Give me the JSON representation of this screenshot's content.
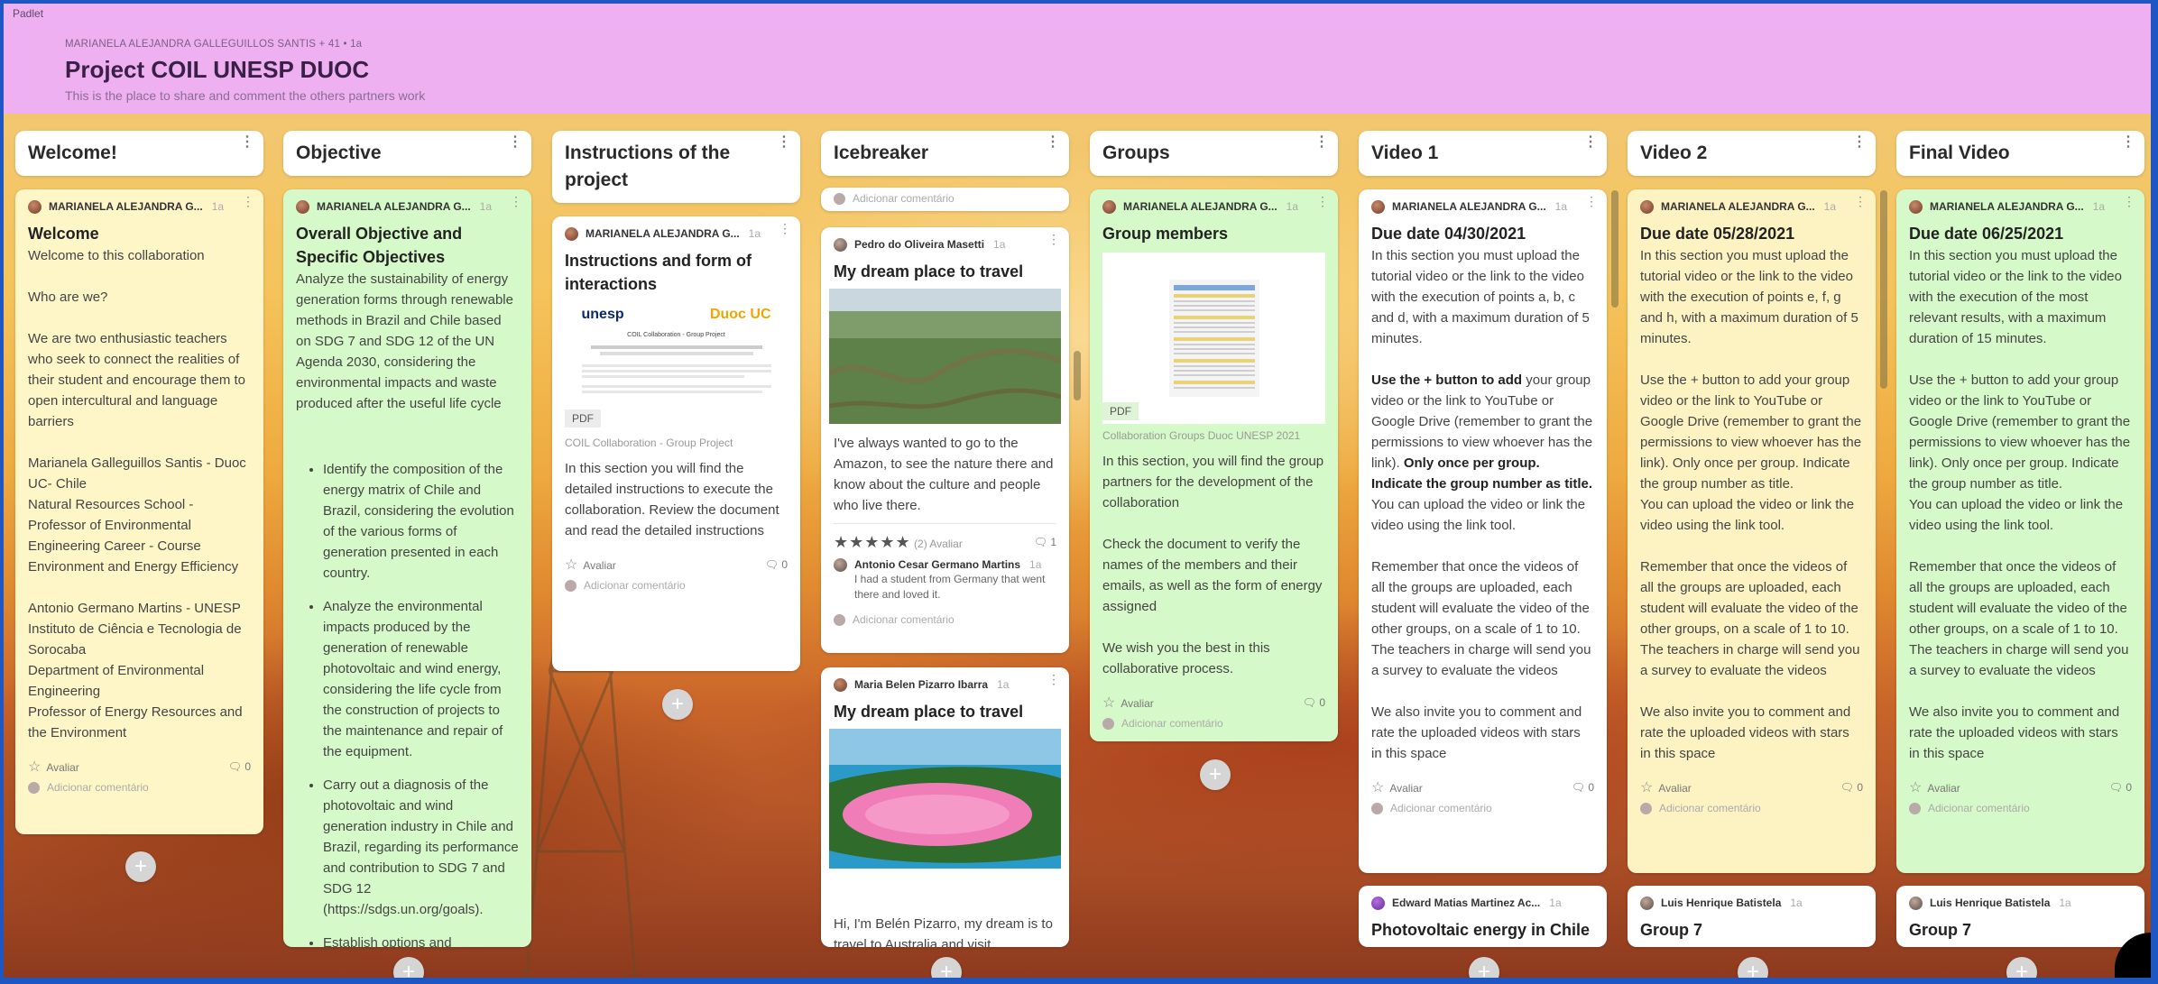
{
  "brand": "Padlet",
  "header": {
    "author_line": "MARIANELA ALEJANDRA GALLEGUILLOS SANTIS + 41 • 1a",
    "title": "Project COIL UNESP DUOC",
    "description": "This is the place to share and comment the others partners work"
  },
  "common": {
    "rate": "Avaliar",
    "add_comment": "Adicionar comentário",
    "zero": "0",
    "age": "1a"
  },
  "columns": [
    {
      "title": "Welcome!",
      "card": {
        "author": "MARIANELA ALEJANDRA G...",
        "title": "Welcome",
        "body": "Welcome to this collaboration\n\nWho are we?\n\nWe are two enthusiastic teachers who seek to connect the realities of their student and encourage them to open intercultural and language barriers\n\nMarianela Galleguillos Santis - Duoc UC- Chile\nNatural Resources School - Professor of Environmental Engineering Career - Course Environment and Energy Efficiency\n\nAntonio Germano Martins - UNESP\nInstituto de Ciência e Tecnologia de Sorocaba\nDepartment of Environmental Engineering\nProfessor  of Energy Resources and the Environment"
      }
    },
    {
      "title": "Objective",
      "card": {
        "author": "MARIANELA ALEJANDRA G...",
        "title": "Overall Objective and Specific Objectives",
        "body": "Analyze the sustainability of energy generation forms through renewable methods in Brazil and Chile based on SDG 7 and SDG 12 of the UN Agenda 2030, considering the environmental impacts and waste produced after the useful life cycle",
        "bullets": [
          "Identify the composition of the energy matrix of Chile and Brazil, considering the evolution of the various forms of generation presented in each country.",
          "Analyze the environmental impacts produced by the generation of renewable photovoltaic and wind energy, considering the life cycle from the construction of projects to the maintenance and repair of the equipment.",
          "Carry out a diagnosis of the photovoltaic and wind generation industry in Chile and Brazil, regarding its performance and contribution to SDG 7 and SDG 12 (https://sdgs.un.org/goals).",
          "Establish options and"
        ]
      }
    },
    {
      "title": "Instructions of the project",
      "card": {
        "author": "MARIANELA ALEJANDRA G...",
        "title": "Instructions and form of interactions",
        "pdf_logo_left": "unesp",
        "pdf_logo_right": "Duoc UC",
        "pdf_heading": "COIL Collaboration - Group Project",
        "pdf_label": "PDF",
        "caption": "COIL Collaboration - Group Project",
        "body": "In this section you will find the detailed instructions to execute the collaboration. Review the document and read the detailed instructions"
      }
    },
    {
      "title": "Icebreaker",
      "top_comment": "Adicionar comentário",
      "card1": {
        "author": "Pedro do Oliveira Masetti",
        "title": "My dream place to travel",
        "body": "I've always wanted to go to the Amazon, to see the nature there and know about the culture and people who live there.",
        "rating_count": "(2) Avaliar",
        "comment_count": "1",
        "reply_author": "Antonio Cesar Germano Martins",
        "reply_text": "I had a student from Germany that went there and loved it."
      },
      "card2": {
        "author": "Maria Belen Pizarro Ibarra",
        "title": "My dream place to travel",
        "body": "Hi, I'm Belén Pizarro, my dream is to travel to Australia and visit"
      }
    },
    {
      "title": "Groups",
      "card": {
        "author": "MARIANELA ALEJANDRA G...",
        "title": "Group members",
        "pdf_label": "PDF",
        "caption": "Collaboration Groups Duoc UNESP 2021",
        "body": "In this section, you will find the group partners for the development of the collaboration\n\nCheck the document to verify the names of the members and their emails, as well as the form of energy assigned\n\nWe wish you the best in this collaborative process."
      }
    },
    {
      "title": "Video 1",
      "card": {
        "author": "MARIANELA ALEJANDRA G...",
        "title": "Due date 04/30/2021",
        "p1": "In this section you must upload the tutorial video or the link to the video with the execution of points a, b, c and d, with a maximum duration of 5 minutes.",
        "p2_bold": "Use the + button to add",
        "p2a": " your group video or the link to YouTube or Google Drive (remember to grant the permissions to view whoever has the link). ",
        "p2_bold2": "Only once per group. Indicate the group number as title.",
        "p2b": "\nYou can upload the video or link the video using the link tool.",
        "p3": "Remember that once the videos of all the groups are uploaded, each student will evaluate the video of the other groups, on a scale of 1 to 10. The teachers in charge will send you a survey to evaluate the videos",
        "p4": "We also invite you to comment and rate the uploaded videos with stars in this space"
      },
      "card2": {
        "author": "Edward Matias Martinez Ac...",
        "title": "Photovoltaic energy in Chile"
      }
    },
    {
      "title": "Video 2",
      "card": {
        "author": "MARIANELA ALEJANDRA G...",
        "title": "Due date 05/28/2021",
        "body": "In this section you must upload the tutorial video or the link to the video with the execution of points e, f, g and h, with a maximum duration of 5 minutes.\n\nUse the + button to add your group video or the link to YouTube or Google Drive (remember to grant the permissions to view whoever has the link). Only once per group. Indicate the group number as title.\nYou can upload the video or link the video using the link tool.\n\nRemember that once the videos of all the groups are uploaded, each student will evaluate the video of the other groups, on a scale of 1 to 10. The teachers in charge will send you a survey to evaluate the videos\n\nWe also invite you to comment and rate the uploaded videos with stars in this space"
      },
      "card2": {
        "author": "Luis Henrique Batistela",
        "title": "Group 7"
      }
    },
    {
      "title": "Final Video",
      "card": {
        "author": "MARIANELA ALEJANDRA G...",
        "title": "Due date 06/25/2021",
        "body": "In this section you must upload the tutorial video or the link to the video with the execution of the most relevant results, with a maximum duration of 15 minutes.\n\nUse the + button to add your group video or the link to YouTube or Google Drive (remember to grant the permissions to view whoever has the link). Only once per group. Indicate the group number as title.\nYou can upload the video or link the video using the link tool.\n\nRemember that once the videos of all the groups are uploaded, each student will evaluate the video of the other groups, on a scale of 1 to 10. The teachers in charge will send you a survey to evaluate the videos\n\nWe also invite you to comment and rate the uploaded videos with stars in this space"
      },
      "card2": {
        "author": "Luis Henrique Batistela",
        "title": "Group 7"
      }
    }
  ]
}
